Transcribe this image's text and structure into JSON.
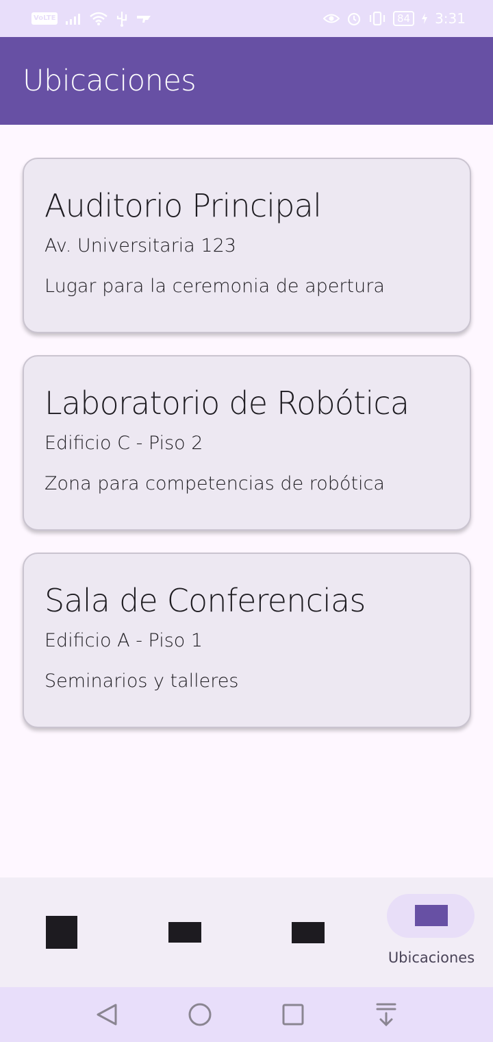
{
  "status_bar": {
    "network_badge": "VoLTE",
    "battery_level": "84",
    "time": "3:31",
    "icons": [
      "volte-icon",
      "signal-icon",
      "wifi-icon",
      "usb-icon",
      "eye-comfort-icon",
      "alarm-icon",
      "vibrate-icon",
      "battery-icon",
      "charging-icon"
    ]
  },
  "app_bar": {
    "title": "Ubicaciones"
  },
  "locations": [
    {
      "name": "Auditorio Principal",
      "address": "Av. Universitaria 123",
      "description": "Lugar para la ceremonia de apertura"
    },
    {
      "name": "Laboratorio de Robótica",
      "address": "Edificio C - Piso 2",
      "description": "Zona para competencias de robótica"
    },
    {
      "name": "Sala de Conferencias",
      "address": "Edificio A - Piso 1",
      "description": "Seminarios y talleres"
    }
  ],
  "bottom_nav": {
    "items": [
      {
        "icon": "placeholder-square-icon",
        "label": ""
      },
      {
        "icon": "placeholder-rect-icon",
        "label": ""
      },
      {
        "icon": "placeholder-rect-icon",
        "label": ""
      },
      {
        "icon": "placeholder-rect-icon",
        "label": "Ubicaciones",
        "selected": true
      }
    ]
  },
  "system_nav": {
    "buttons": [
      "back-icon",
      "home-icon",
      "recents-icon",
      "notification-pull-icon"
    ]
  },
  "colors": {
    "primary": "#6750a4",
    "status_bar_bg": "#e8defa",
    "surface": "#fef7ff",
    "card_bg": "#ede8f2",
    "nav_indicator": "#e8def8",
    "on_surface": "#1d1b20"
  }
}
